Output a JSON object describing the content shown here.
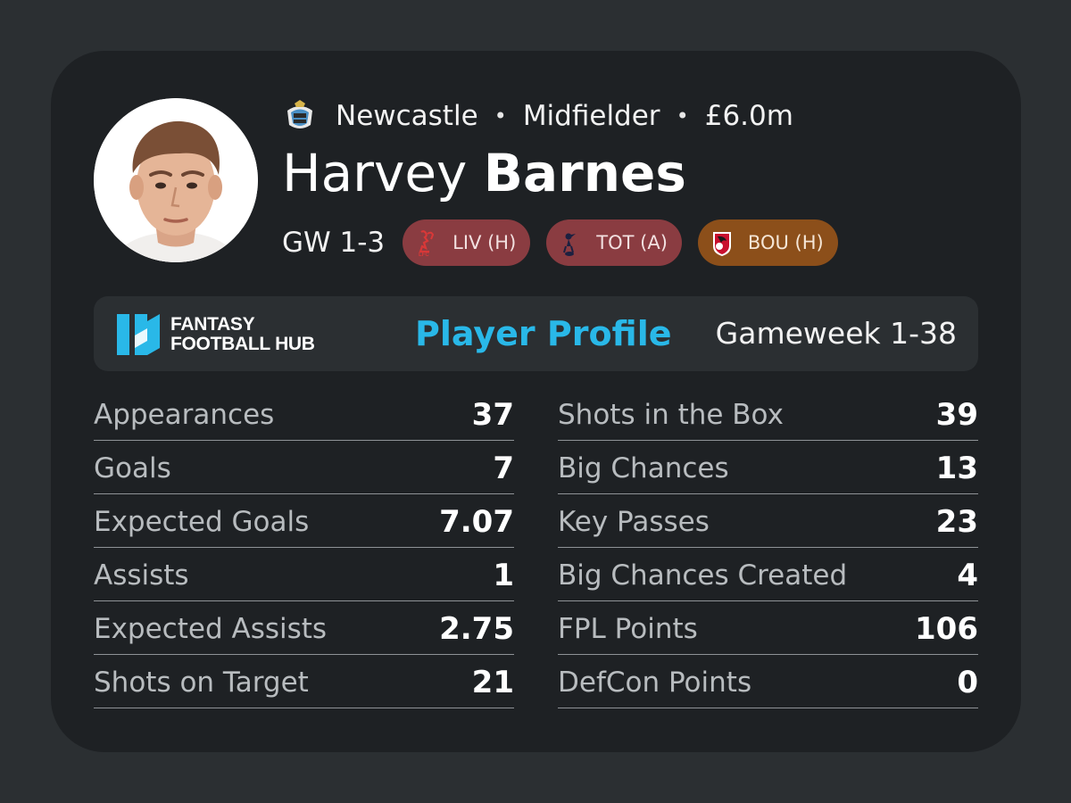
{
  "player": {
    "club": "Newcastle",
    "position": "Midfielder",
    "price": "£6.0m",
    "first_name": "Harvey",
    "last_name": "Barnes",
    "separator": "•"
  },
  "fixtures": {
    "label": "GW 1-3",
    "items": [
      {
        "text": "LIV (H)",
        "crest": "liverpool-crest-icon",
        "color": "#8a3c41"
      },
      {
        "text": "TOT (A)",
        "crest": "tottenham-crest-icon",
        "color": "#8a3c41"
      },
      {
        "text": "BOU (H)",
        "crest": "bournemouth-crest-icon",
        "color": "#8c4f1a"
      }
    ]
  },
  "banner": {
    "brand_line1": "FANTASY",
    "brand_line2": "FOOTBALL HUB",
    "title": "Player Profile",
    "range": "Gameweek 1-38",
    "accent_color": "#29b8e8"
  },
  "stats": {
    "left": [
      {
        "label": "Appearances",
        "value": "37"
      },
      {
        "label": "Goals",
        "value": "7"
      },
      {
        "label": "Expected Goals",
        "value": "7.07"
      },
      {
        "label": "Assists",
        "value": "1"
      },
      {
        "label": "Expected Assists",
        "value": "2.75"
      },
      {
        "label": "Shots on Target",
        "value": "21"
      }
    ],
    "right": [
      {
        "label": "Shots in the Box",
        "value": "39"
      },
      {
        "label": "Big Chances",
        "value": "13"
      },
      {
        "label": "Key Passes",
        "value": "23"
      },
      {
        "label": "Big Chances Created",
        "value": "4"
      },
      {
        "label": "FPL Points",
        "value": "106"
      },
      {
        "label": "DefCon Points",
        "value": "0"
      }
    ]
  }
}
